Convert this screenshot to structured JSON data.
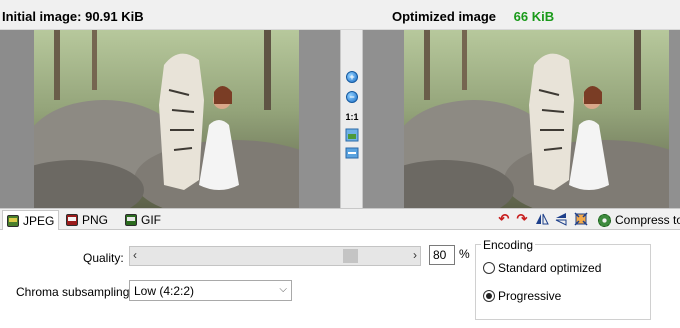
{
  "header": {
    "initial_label": "Initial image:",
    "initial_size": "90.91 KiB",
    "optimized_label": "Optimized image",
    "optimized_size": "66 KiB",
    "optimized_size_color": "#1a9a1a"
  },
  "view_tools": {
    "zoom_ratio_label": "1:1"
  },
  "format_tabs": [
    {
      "label": "JPEG",
      "icon": "jpeg-file-icon",
      "active": true
    },
    {
      "label": "PNG",
      "icon": "png-file-icon",
      "active": false
    },
    {
      "label": "GIF",
      "icon": "gif-file-icon",
      "active": false
    }
  ],
  "actions": {
    "compress_label": "Compress to"
  },
  "settings": {
    "quality_label": "Quality:",
    "quality_value": "80",
    "quality_unit": "%",
    "quality_level": 0.8,
    "chroma_label": "Chroma subsampling:",
    "chroma_value": "Low (4:2:2)",
    "encoding_legend": "Encoding",
    "encoding_options": [
      {
        "label": "Standard optimized",
        "selected": false
      },
      {
        "label": "Progressive",
        "selected": true
      }
    ]
  }
}
